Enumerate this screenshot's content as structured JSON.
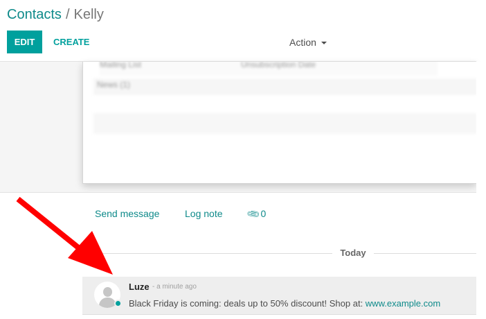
{
  "breadcrumb": {
    "parent": "Contacts",
    "separator": "/",
    "current": "Kelly"
  },
  "toolbar": {
    "edit_label": "EDIT",
    "create_label": "CREATE",
    "action_label": "Action"
  },
  "form": {
    "blurred_field_1_label": "Mailing List",
    "blurred_field_1_value": "Unsubscription Date",
    "blurred_field_2_label": "News (1)"
  },
  "chatter": {
    "send_message_label": "Send message",
    "log_note_label": "Log note",
    "attachment_count": "0",
    "date_separator": "Today",
    "messages": [
      {
        "author": "Luze",
        "date": "- a minute ago",
        "body_text": "Black Friday is coming: deals up to 50% discount! Shop at: ",
        "link_text": "www.example.com",
        "online": true
      }
    ]
  },
  "colors": {
    "brand": "#00a09d",
    "link": "#0e8a8a",
    "annotation_arrow": "#ff0000"
  },
  "icons": {
    "attachment": "paperclip-icon",
    "dropdown": "caret-down-icon",
    "avatar": "user-placeholder-icon",
    "annotation": "red-arrow-icon"
  }
}
